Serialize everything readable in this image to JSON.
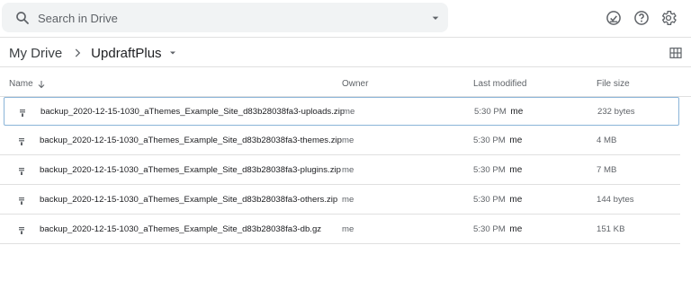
{
  "search": {
    "placeholder": "Search in Drive"
  },
  "toolbar": {
    "icons": [
      "offline-ready-icon",
      "help-icon",
      "settings-icon"
    ]
  },
  "breadcrumb": {
    "root": "My Drive",
    "current": "UpdraftPlus"
  },
  "columns": {
    "name": "Name",
    "owner": "Owner",
    "last_modified": "Last modified",
    "file_size": "File size"
  },
  "files": [
    {
      "name": "backup_2020-12-15-1030_aThemes_Example_Site_d83b28038fa3-uploads.zip",
      "owner": "me",
      "modified_time": "5:30 PM",
      "modified_by": "me",
      "size": "232 bytes",
      "selected": true
    },
    {
      "name": "backup_2020-12-15-1030_aThemes_Example_Site_d83b28038fa3-themes.zip",
      "owner": "me",
      "modified_time": "5:30 PM",
      "modified_by": "me",
      "size": "4 MB",
      "selected": false
    },
    {
      "name": "backup_2020-12-15-1030_aThemes_Example_Site_d83b28038fa3-plugins.zip",
      "owner": "me",
      "modified_time": "5:30 PM",
      "modified_by": "me",
      "size": "7 MB",
      "selected": false
    },
    {
      "name": "backup_2020-12-15-1030_aThemes_Example_Site_d83b28038fa3-others.zip",
      "owner": "me",
      "modified_time": "5:30 PM",
      "modified_by": "me",
      "size": "144 bytes",
      "selected": false
    },
    {
      "name": "backup_2020-12-15-1030_aThemes_Example_Site_d83b28038fa3-db.gz",
      "owner": "me",
      "modified_time": "5:30 PM",
      "modified_by": "me",
      "size": "151 KB",
      "selected": false
    }
  ],
  "colors": {
    "selection_border": "#8ab4d8",
    "divider": "#e0e0e0",
    "search_bg": "#f1f3f4"
  }
}
